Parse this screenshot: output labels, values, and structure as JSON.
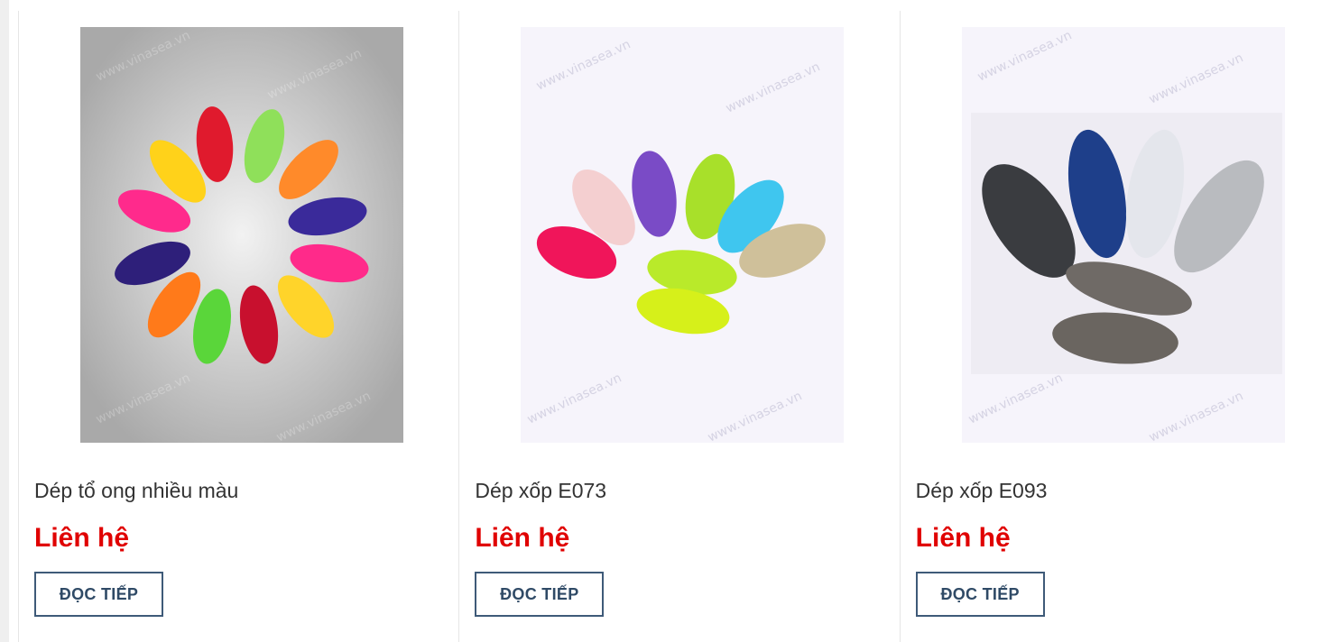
{
  "products": [
    {
      "title": "Dép tổ ong nhiều màu",
      "price": "Liên hệ",
      "button": "ĐỌC TIẾP",
      "image_icon": "colorful-slippers-circle-image",
      "watermark": "www.vinasea.vn"
    },
    {
      "title": "Dép xốp E073",
      "price": "Liên hệ",
      "button": "ĐỌC TIẾP",
      "image_icon": "colorful-clogs-fan-image",
      "watermark": "www.vinasea.vn"
    },
    {
      "title": "Dép xốp E093",
      "price": "Liên hệ",
      "button": "ĐỌC TIẾP",
      "image_icon": "dark-clogs-image",
      "watermark": "www.vinasea.vn"
    }
  ],
  "colors": {
    "price": "#e00000",
    "button_border": "#3e5a78",
    "title": "#333333"
  }
}
